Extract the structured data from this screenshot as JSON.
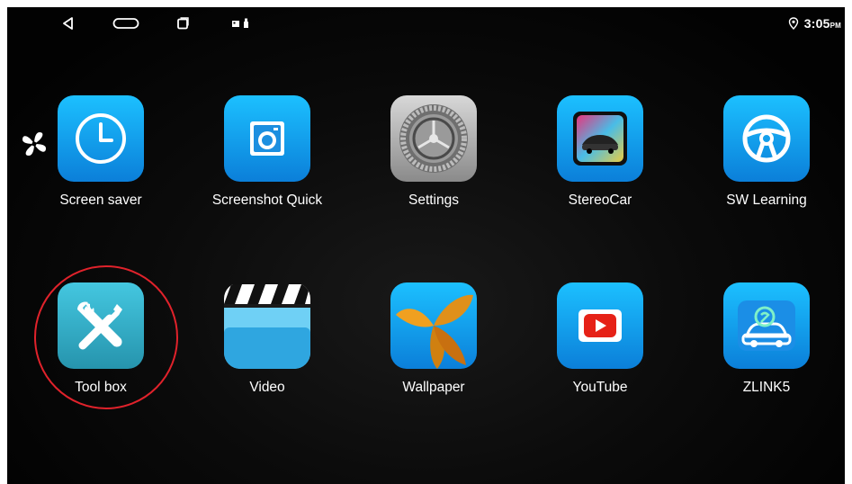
{
  "status_bar": {
    "time": "3:05",
    "ampm": "PM"
  },
  "apps": [
    {
      "label": "Screen saver",
      "icon": "clock-icon"
    },
    {
      "label": "Screenshot Quick",
      "icon": "camera-icon"
    },
    {
      "label": "Settings",
      "icon": "settings-gear-icon"
    },
    {
      "label": "StereoCar",
      "icon": "stereocar-icon"
    },
    {
      "label": "SW Learning",
      "icon": "steering-wheel-icon"
    },
    {
      "label": "Tool box",
      "icon": "wrench-screwdriver-icon"
    },
    {
      "label": "Video",
      "icon": "clapperboard-icon"
    },
    {
      "label": "Wallpaper",
      "icon": "leaves-icon"
    },
    {
      "label": "YouTube",
      "icon": "youtube-icon"
    },
    {
      "label": "ZLINK5",
      "icon": "zlink-car-icon"
    }
  ],
  "colors": {
    "app_blue": "#0b7fd9",
    "highlight_circle": "#e0222b",
    "youtube_red": "#e62117"
  }
}
